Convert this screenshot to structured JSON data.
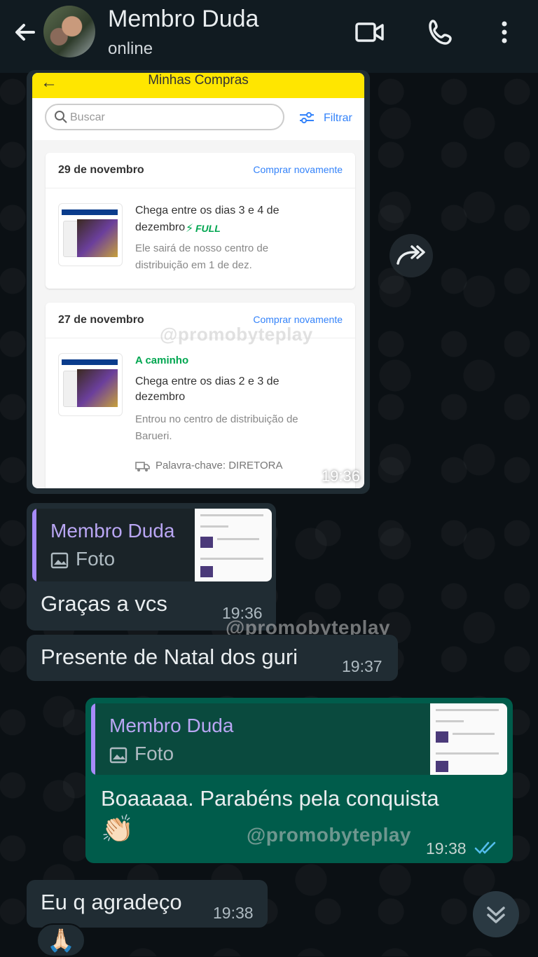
{
  "header": {
    "contact_name": "Membro Duda",
    "status": "online"
  },
  "screenshot": {
    "title": "Minhas Compras",
    "search_placeholder": "Buscar",
    "filter_label": "Filtrar",
    "orders": [
      {
        "date": "29 de novembro",
        "buy_again": "Comprar novamente",
        "line1": "Chega entre os dias 3 e 4 de",
        "line2": "dezembro",
        "badge": "FULL",
        "sub1": "Ele sairá de nosso centro de",
        "sub2": "distribuição em 1 de dez."
      },
      {
        "date": "27 de novembro",
        "buy_again": "Comprar novamente",
        "status": "A caminho",
        "line1": "Chega entre os dias 2 e 3 de",
        "line2": "dezembro",
        "sub1": "Entrou no centro de distribuição de",
        "sub2": "Barueri.",
        "keyword": "Palavra-chave: DIRETORA"
      }
    ],
    "time": "19:36"
  },
  "watermark": "@promobyteplay",
  "messages": [
    {
      "quote_name": "Membro Duda",
      "quote_type": "Foto",
      "text": "Graças a vcs",
      "time": "19:36"
    },
    {
      "text": "Presente de Natal dos guri",
      "time": "19:37"
    },
    {
      "quote_name": "Membro Duda",
      "quote_type": "Foto",
      "text": "Boaaaaa. Parabéns pela conquista",
      "emoji": "👏🏻",
      "time": "19:38",
      "status": "read"
    },
    {
      "text": "Eu q agradeço",
      "time": "19:38",
      "reaction": "🙏🏻"
    }
  ],
  "colors": {
    "header_bg": "#111b21",
    "incoming_bubble": "#202c33",
    "outgoing_bubble": "#005c4b",
    "quote_accent": "#a78bfa",
    "read_ticks": "#53bdeb",
    "ml_yellow": "#ffe600"
  },
  "icons": [
    "back-arrow-icon",
    "video-call-icon",
    "phone-icon",
    "more-vert-icon",
    "forward-icon",
    "photo-icon",
    "double-check-icon",
    "scroll-down-icon"
  ]
}
